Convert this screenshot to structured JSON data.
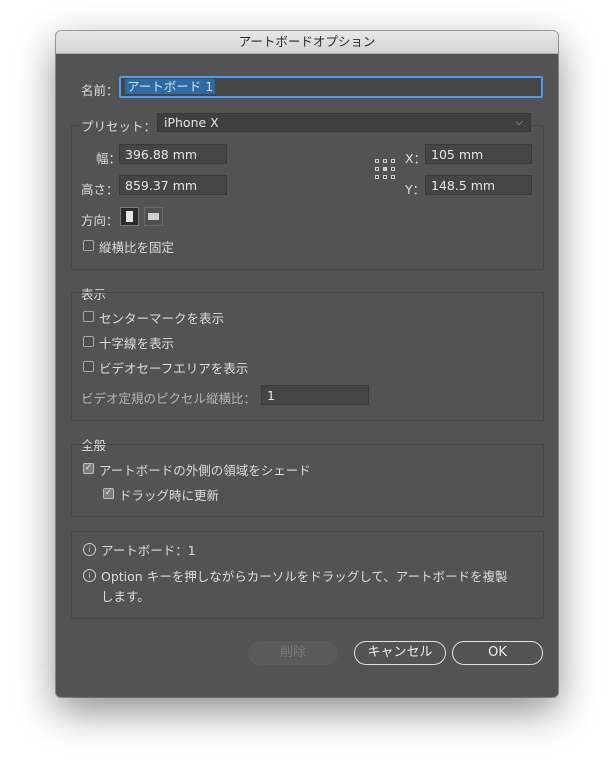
{
  "window": {
    "title": "アートボードオプション"
  },
  "name": {
    "label": "名前：",
    "value": "アートボード 1"
  },
  "preset": {
    "label": "プリセット：",
    "value": "iPhone X"
  },
  "dimensions": {
    "width_label": "幅：",
    "width_value": "396.88 mm",
    "height_label": "高さ：",
    "height_value": "859.37 mm",
    "x_label": "X：",
    "x_value": "105 mm",
    "y_label": "Y：",
    "y_value": "148.5 mm",
    "orientation_label": "方向：",
    "lock_ratio_label": "縦横比を固定",
    "lock_ratio_checked": false
  },
  "display": {
    "section_label": "表示",
    "center_mark_label": "センターマークを表示",
    "crosshair_label": "十字線を表示",
    "video_safe_label": "ビデオセーフエリアを表示",
    "pixel_ratio_label": "ビデオ定規のピクセル縦横比：",
    "pixel_ratio_value": "1"
  },
  "general": {
    "section_label": "全般",
    "shade_outside_label": "アートボードの外側の領域をシェード",
    "shade_outside_checked": true,
    "update_drag_label": "ドラッグ時に更新",
    "update_drag_checked": true
  },
  "info": {
    "line1": "アートボード：1",
    "line2a": "Option キーを押しながらカーソルをドラッグして、アートボードを複製",
    "line2b": "します。"
  },
  "buttons": {
    "delete": "削除",
    "cancel": "キャンセル",
    "ok": "OK"
  },
  "icons": {
    "check": "✓",
    "chevron": "⌵",
    "info": "i"
  }
}
